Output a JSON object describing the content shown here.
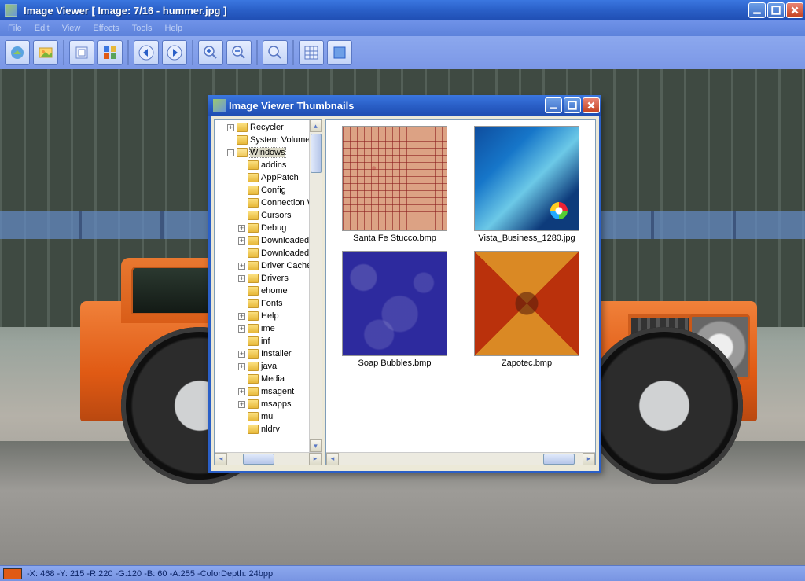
{
  "main": {
    "title": "Image Viewer [ Image: 7/16 - hummer.jpg ]"
  },
  "menu": {
    "file": "File",
    "edit": "Edit",
    "view": "View",
    "effects": "Effects",
    "tools": "Tools",
    "help": "Help"
  },
  "status": {
    "text": "-X: 468   -Y: 215  -R:220  -G:120  -B: 60  -A:255  -ColorDepth: 24bpp",
    "swatch_color": "#e05a14"
  },
  "child": {
    "title": "Image Viewer Thumbnails"
  },
  "tree": {
    "items": [
      {
        "indent": 1,
        "exp": "+",
        "label": "Recycler"
      },
      {
        "indent": 1,
        "exp": "",
        "label": "System Volume Information"
      },
      {
        "indent": 1,
        "exp": "-",
        "label": "Windows",
        "open": true,
        "selected": true
      },
      {
        "indent": 2,
        "exp": "",
        "label": "addins"
      },
      {
        "indent": 2,
        "exp": "",
        "label": "AppPatch"
      },
      {
        "indent": 2,
        "exp": "",
        "label": "Config"
      },
      {
        "indent": 2,
        "exp": "",
        "label": "Connection Wizard"
      },
      {
        "indent": 2,
        "exp": "",
        "label": "Cursors"
      },
      {
        "indent": 2,
        "exp": "+",
        "label": "Debug"
      },
      {
        "indent": 2,
        "exp": "+",
        "label": "Downloaded Installations"
      },
      {
        "indent": 2,
        "exp": "",
        "label": "Downloaded Program Files"
      },
      {
        "indent": 2,
        "exp": "+",
        "label": "Driver Cache"
      },
      {
        "indent": 2,
        "exp": "+",
        "label": "Drivers"
      },
      {
        "indent": 2,
        "exp": "",
        "label": "ehome"
      },
      {
        "indent": 2,
        "exp": "",
        "label": "Fonts"
      },
      {
        "indent": 2,
        "exp": "+",
        "label": "Help"
      },
      {
        "indent": 2,
        "exp": "+",
        "label": "ime"
      },
      {
        "indent": 2,
        "exp": "",
        "label": "inf"
      },
      {
        "indent": 2,
        "exp": "+",
        "label": "Installer"
      },
      {
        "indent": 2,
        "exp": "+",
        "label": "java"
      },
      {
        "indent": 2,
        "exp": "",
        "label": "Media"
      },
      {
        "indent": 2,
        "exp": "+",
        "label": "msagent"
      },
      {
        "indent": 2,
        "exp": "+",
        "label": "msapps"
      },
      {
        "indent": 2,
        "exp": "",
        "label": "mui"
      },
      {
        "indent": 2,
        "exp": "",
        "label": "nldrv"
      }
    ]
  },
  "thumbs": [
    {
      "label": "Santa Fe Stucco.bmp",
      "class": "thumb-santafe"
    },
    {
      "label": "Vista_Business_1280.jpg",
      "class": "thumb-vista"
    },
    {
      "label": "Soap Bubbles.bmp",
      "class": "thumb-soap"
    },
    {
      "label": "Zapotec.bmp",
      "class": "thumb-zapotec"
    }
  ]
}
